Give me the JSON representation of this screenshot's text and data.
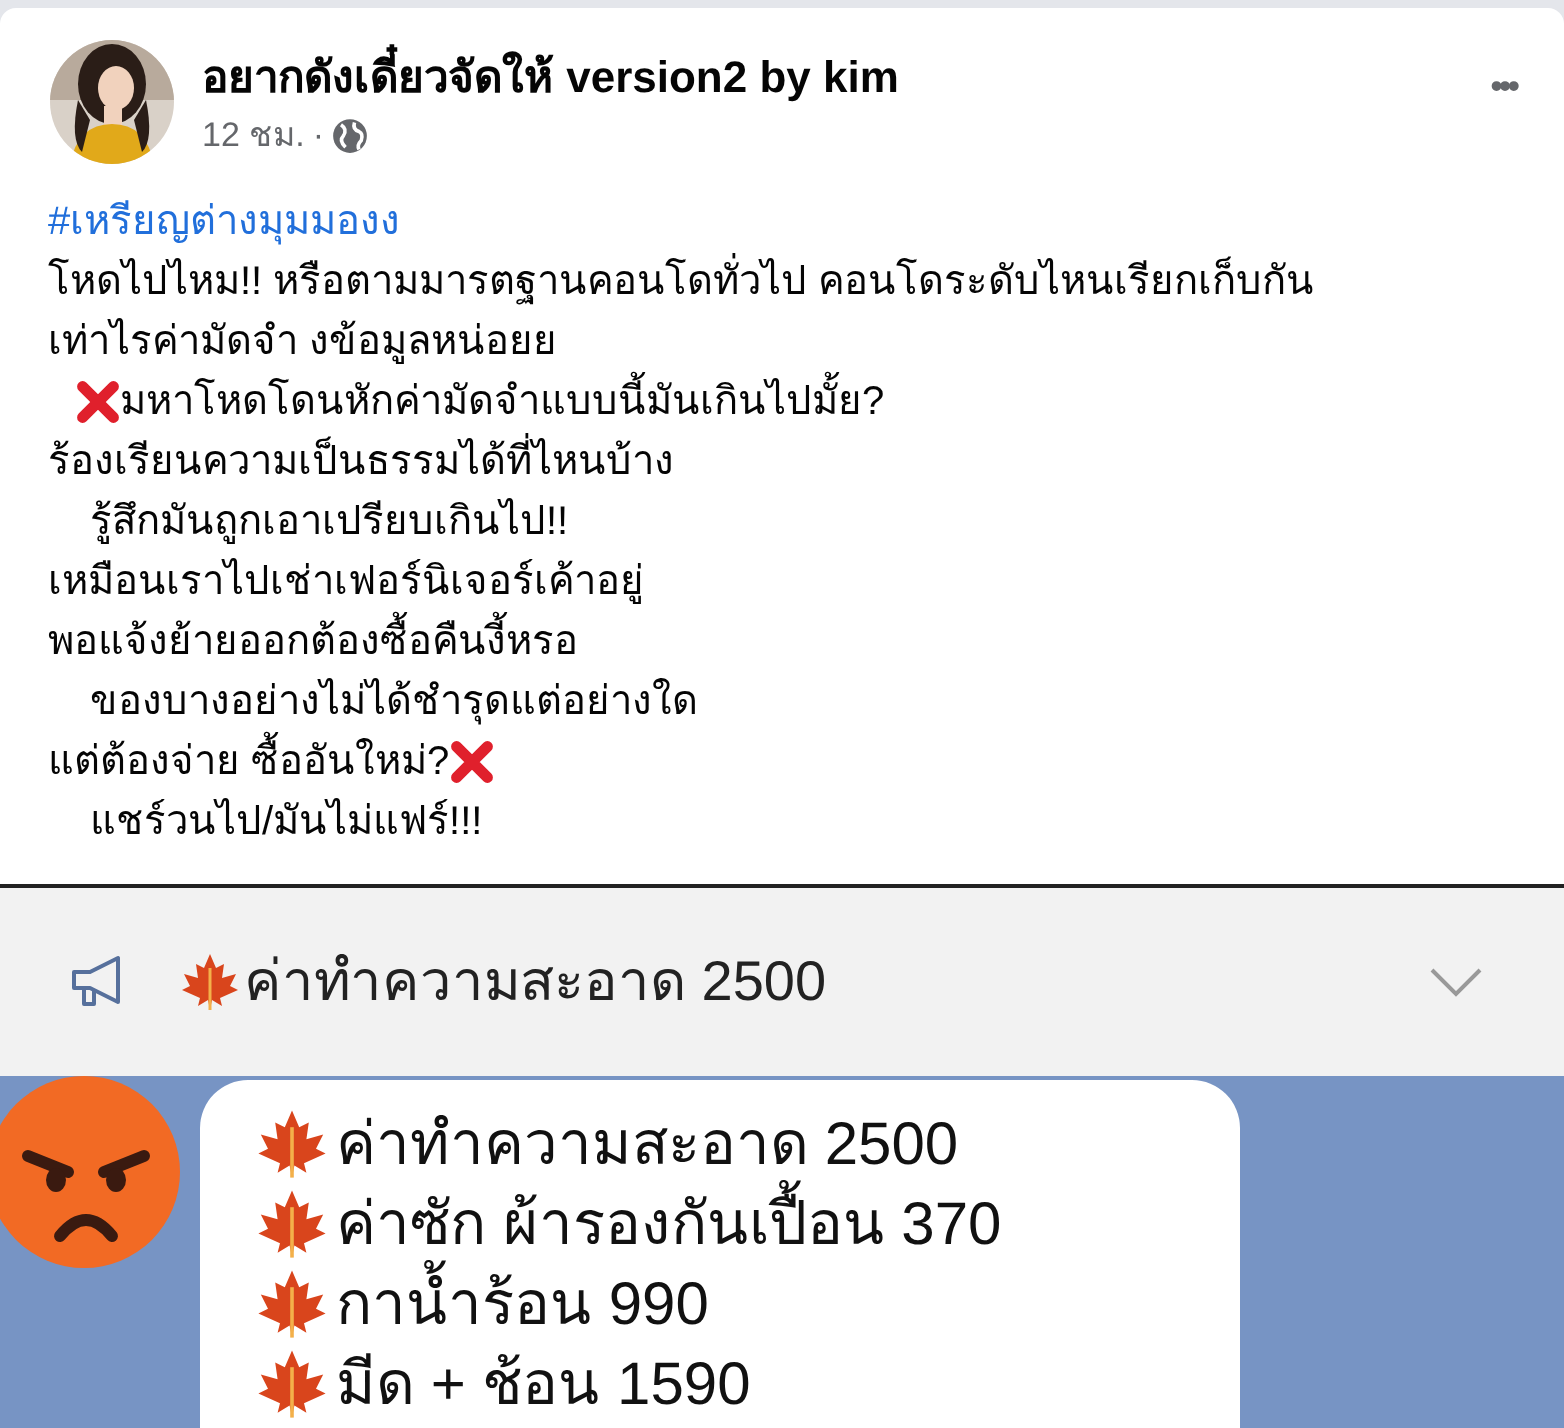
{
  "post": {
    "author": "อยากดังเดี๋ยวจัดให้ version2 by kim",
    "time": "12 ชม.",
    "separator": "·",
    "more": "•••",
    "hashtag": "#เหรียญต่างมุมมองง",
    "lines": [
      {
        "kind": "plain",
        "text": "โหดไปไหม!! หรือตามมารตฐานคอนโดทั่วไป  คอนโดระดับไหนเรียกเก็บกัน",
        "indented": false
      },
      {
        "kind": "plain",
        "text": "เท่าไรค่ามัดจำ งข้อมูลหน่อยย",
        "indented": false
      },
      {
        "kind": "premarked",
        "text": "มหาโหดโดนหักค่ามัดจำแบบนี้มันเกินไปมั้ย?",
        "indented": true
      },
      {
        "kind": "plain",
        "text": "ร้องเรียนความเป็นธรรมได้ที่ไหนบ้าง",
        "indented": false
      },
      {
        "kind": "plain",
        "text": "รู้สึกมันถูกเอาเปรียบเกินไป!!",
        "indented": true
      },
      {
        "kind": "plain",
        "text": "เหมือนเราไปเช่าเฟอร์นิเจอร์เค้าอยู่",
        "indented": false
      },
      {
        "kind": "plain",
        "text": "พอแจ้งย้ายออกต้องซื้อคืนงี้หรอ",
        "indented": false
      },
      {
        "kind": "plain",
        "text": "ของบางอย่างไม่ได้ชำรุดแต่อย่างใด",
        "indented": true
      },
      {
        "kind": "postmarked",
        "text": "แต่ต้องจ่าย ซื้ออันใหม่?",
        "indented": false
      },
      {
        "kind": "plain",
        "text": "แชร์วนไป/มันไม่แฟร์!!!",
        "indented": true
      }
    ]
  },
  "chat_screenshot": {
    "announcement": "ค่าทำความสะอาด 2500",
    "message_items": [
      "ค่าทำความสะอาด 2500",
      "ค่าซัก ผ้ารองกันเปื้อน 370",
      "กาน้ำร้อน 990",
      "มีด + ช้อน 1590"
    ]
  }
}
